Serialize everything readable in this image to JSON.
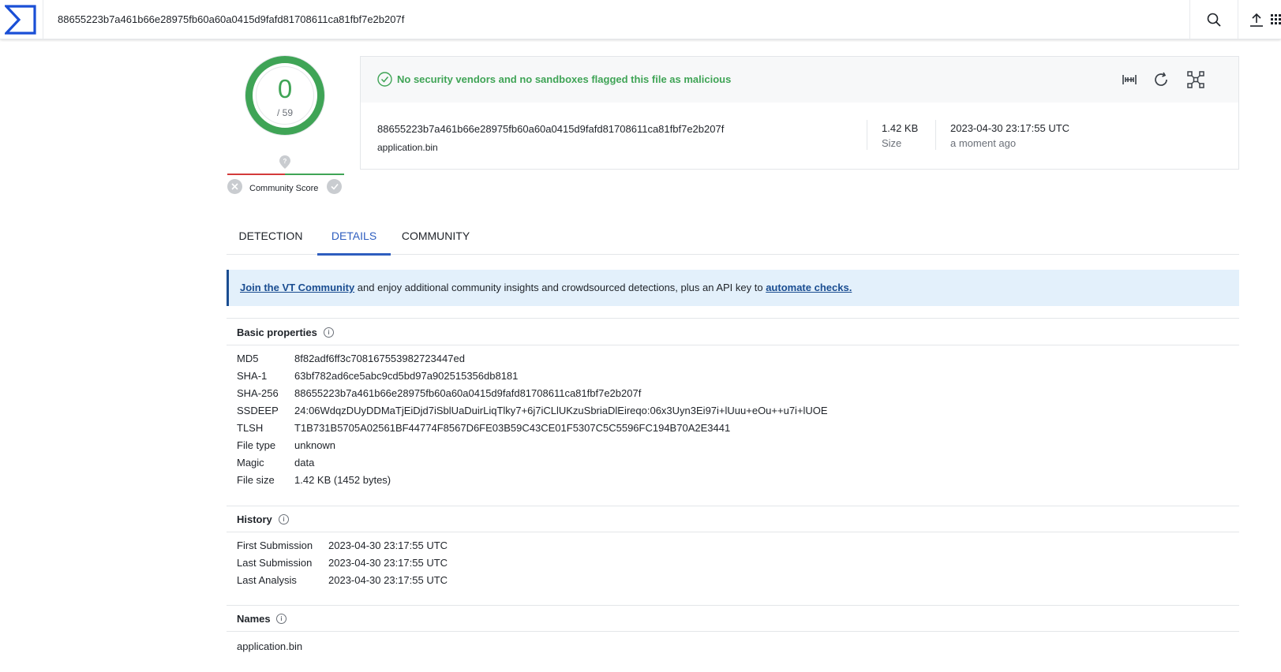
{
  "search": {
    "query": "88655223b7a461b66e28975fb60a60a0415d9fafd81708611ca81fbf7e2b207f"
  },
  "score": {
    "detections": "0",
    "total": "/ 59",
    "community_label": "Community Score"
  },
  "summary": {
    "status": "No security vendors and no sandboxes flagged this file as malicious",
    "hash": "88655223b7a461b66e28975fb60a60a0415d9fafd81708611ca81fbf7e2b207f",
    "file_name": "application.bin",
    "size_value": "1.42 KB",
    "size_label": "Size",
    "date_value": "2023-04-30 23:17:55 UTC",
    "date_label": "a moment ago"
  },
  "tabs": [
    {
      "label": "DETECTION",
      "active": false
    },
    {
      "label": "DETAILS",
      "active": true
    },
    {
      "label": "COMMUNITY",
      "active": false
    }
  ],
  "banner": {
    "link1": "Join the VT Community",
    "text": " and enjoy additional community insights and crowdsourced detections, plus an API key to ",
    "link2": "automate checks."
  },
  "basic": {
    "title": "Basic properties",
    "rows": [
      {
        "k": "MD5",
        "v": "8f82adf6ff3c708167553982723447ed"
      },
      {
        "k": "SHA-1",
        "v": "63bf782ad6ce5abc9cd5bd97a902515356db8181"
      },
      {
        "k": "SHA-256",
        "v": "88655223b7a461b66e28975fb60a60a0415d9fafd81708611ca81fbf7e2b207f"
      },
      {
        "k": "SSDEEP",
        "v": "24:06WdqzDUyDDMaTjEiDjd7iSblUaDuirLiqTlky7+6j7iCLlUKzuSbriaDlEireqo:06x3Uyn3Ei97i+lUuu+eOu++u7i+lUOE"
      },
      {
        "k": "TLSH",
        "v": "T1B731B5705A02561BF44774F8567D6FE03B59C43CE01F5307C5C5596FC194B70A2E3441"
      },
      {
        "k": "File type",
        "v": "unknown"
      },
      {
        "k": "Magic",
        "v": "data"
      },
      {
        "k": "File size",
        "v": "1.42 KB (1452 bytes)"
      }
    ]
  },
  "history": {
    "title": "History",
    "rows": [
      {
        "k": "First Submission",
        "v": "2023-04-30 23:17:55 UTC"
      },
      {
        "k": "Last Submission",
        "v": "2023-04-30 23:17:55 UTC"
      },
      {
        "k": "Last Analysis",
        "v": "2023-04-30 23:17:55 UTC"
      }
    ]
  },
  "names": {
    "title": "Names",
    "items": [
      "application.bin"
    ]
  },
  "colors": {
    "accent": "#2e5ebf",
    "success": "#3fa456",
    "danger": "#d33b3b",
    "banner_bg": "#e3f0fb",
    "brand": "#1a4fd6"
  }
}
